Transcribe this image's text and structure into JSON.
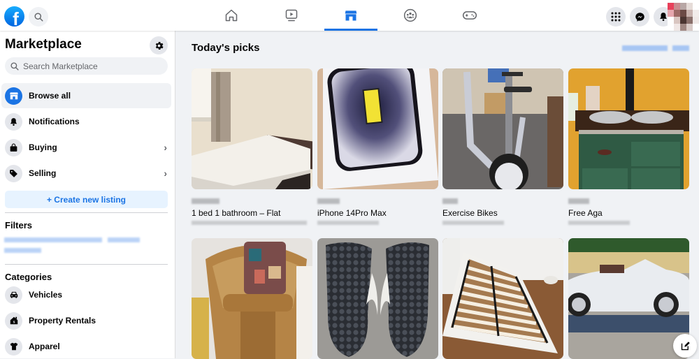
{
  "topbar": {
    "logo_letter": "f",
    "nav_tabs": [
      {
        "name": "home",
        "icon": "home-icon",
        "active": false
      },
      {
        "name": "watch",
        "icon": "video-icon",
        "active": false
      },
      {
        "name": "marketplace",
        "icon": "marketplace-store-icon",
        "active": true
      },
      {
        "name": "groups",
        "icon": "groups-icon",
        "active": false
      },
      {
        "name": "gaming",
        "icon": "gaming-controller-icon",
        "active": false
      }
    ],
    "right_icons": [
      "menu-grid-icon",
      "messenger-icon",
      "notifications-bell-icon"
    ],
    "accent_color": "#1b74e4"
  },
  "sidebar": {
    "title": "Marketplace",
    "search_placeholder": "Search Marketplace",
    "items": [
      {
        "label": "Browse all",
        "icon": "store-icon",
        "active": true,
        "chevron": false
      },
      {
        "label": "Notifications",
        "icon": "bell-icon",
        "active": false,
        "chevron": false
      },
      {
        "label": "Buying",
        "icon": "shopping-bag-icon",
        "active": false,
        "chevron": true
      },
      {
        "label": "Selling",
        "icon": "tag-icon",
        "active": false,
        "chevron": true
      }
    ],
    "create_listing_label": "+ Create new listing",
    "filters_title": "Filters",
    "categories_title": "Categories",
    "categories": [
      {
        "label": "Vehicles",
        "icon": "car-icon"
      },
      {
        "label": "Property Rentals",
        "icon": "house-icon"
      },
      {
        "label": "Apparel",
        "icon": "shirt-icon"
      }
    ]
  },
  "main": {
    "section_title": "Today's picks",
    "listings": [
      {
        "title": "1 bed 1 bathroom – Flat"
      },
      {
        "title": "iPhone 14Pro Max"
      },
      {
        "title": "Exercise Bikes"
      },
      {
        "title": "Free Aga"
      },
      {
        "title": ""
      },
      {
        "title": ""
      },
      {
        "title": ""
      },
      {
        "title": ""
      }
    ]
  }
}
